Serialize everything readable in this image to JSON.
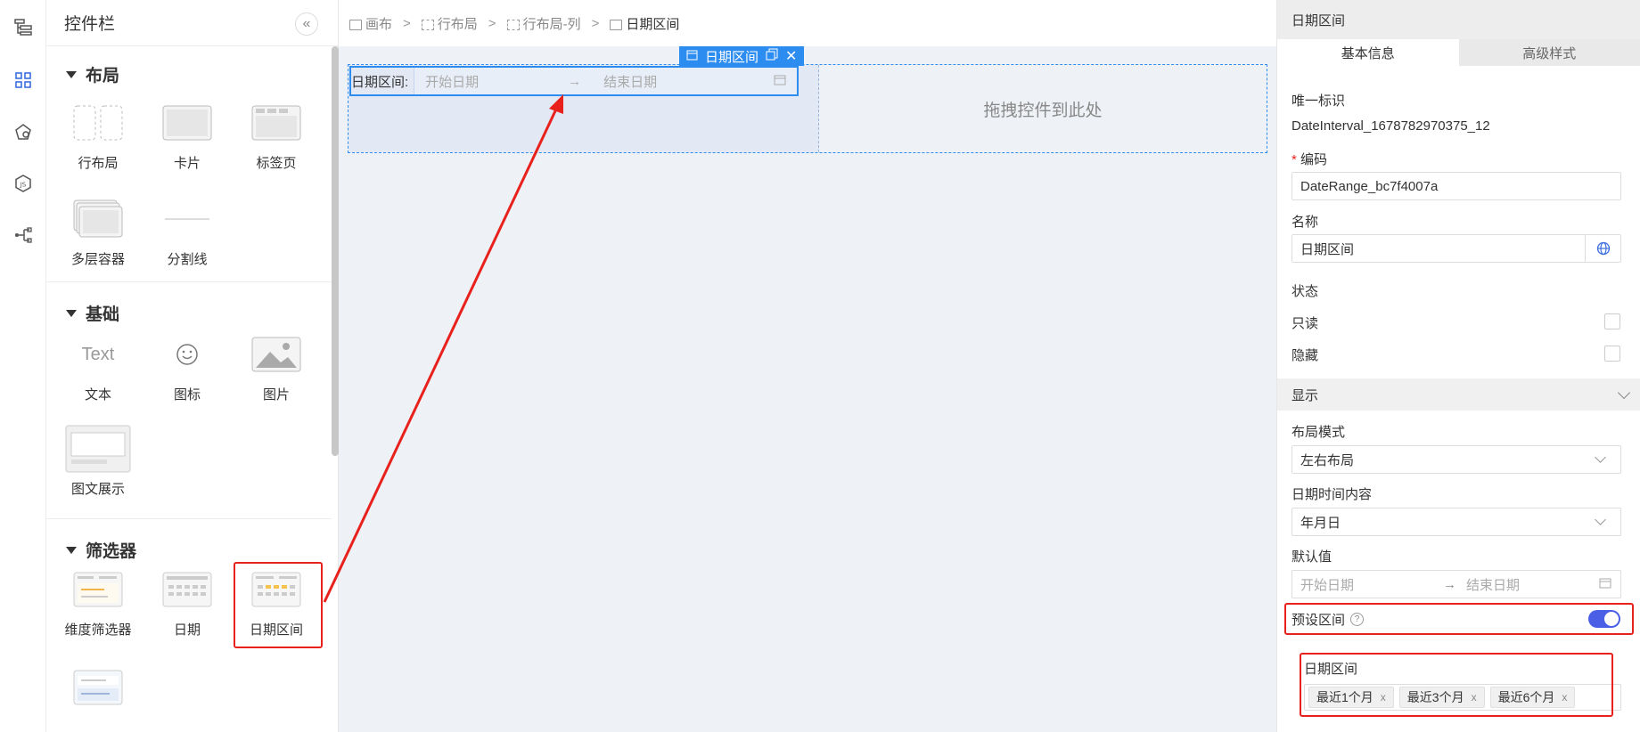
{
  "left_panel": {
    "title": "控件栏",
    "collapse_glyph": "«",
    "sections": {
      "layout": {
        "title": "布局",
        "items": [
          "行布局",
          "卡片",
          "标签页",
          "多层容器",
          "分割线"
        ]
      },
      "basic": {
        "title": "基础",
        "items": [
          "文本",
          "图标",
          "图片",
          "图文展示"
        ],
        "text_thumb": "Text"
      },
      "filter": {
        "title": "筛选器",
        "items": [
          "维度筛选器",
          "日期",
          "日期区间"
        ]
      }
    }
  },
  "breadcrumb": {
    "items": [
      "画布",
      "行布局",
      "行布局-列",
      "日期区间"
    ],
    "separator": ">"
  },
  "canvas": {
    "selected_tag": "日期区间",
    "date_widget": {
      "label": "日期区间:",
      "start_placeholder": "开始日期",
      "end_placeholder": "结束日期",
      "arrow": "→"
    },
    "drop_hint": "拖拽控件到此处"
  },
  "props": {
    "title": "日期区间",
    "tabs": [
      "基本信息",
      "高级样式"
    ],
    "unique_id": {
      "label": "唯一标识",
      "value": "DateInterval_1678782970375_12"
    },
    "code": {
      "required_mark": "*",
      "label": "编码",
      "value": "DateRange_bc7f4007a"
    },
    "name": {
      "label": "名称",
      "value": "日期区间"
    },
    "status": {
      "label": "状态",
      "readonly": "只读",
      "hidden": "隐藏"
    },
    "display": {
      "label": "显示",
      "layout_mode": {
        "label": "布局模式",
        "value": "左右布局"
      },
      "date_content": {
        "label": "日期时间内容",
        "value": "年月日"
      },
      "default": {
        "label": "默认值",
        "start_placeholder": "开始日期",
        "end_placeholder": "结束日期",
        "arrow": "→"
      },
      "preset": {
        "label": "预设区间",
        "help": "?",
        "enabled": true
      },
      "interval": {
        "label": "日期区间",
        "chips": [
          "最近1个月",
          "最近3个月",
          "最近6个月"
        ],
        "chip_close": "x"
      }
    }
  },
  "colors": {
    "accent": "#2d8cf0",
    "toggle": "#4b5ee6",
    "highlight": "#e8211d",
    "canvas_bg": "#eef1f6"
  }
}
